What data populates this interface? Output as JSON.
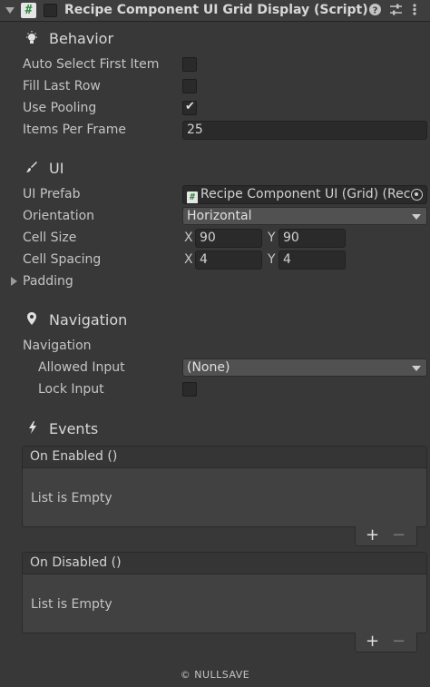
{
  "header": {
    "title": "Recipe Component UI Grid Display (Script)",
    "script_icon": "#",
    "icons": [
      "help-icon",
      "presets-icon",
      "more-icon"
    ]
  },
  "behavior": {
    "title": "Behavior",
    "auto_select_label": "Auto Select First Item",
    "auto_select_checked": false,
    "fill_last_row_label": "Fill Last Row",
    "fill_last_row_checked": false,
    "use_pooling_label": "Use Pooling",
    "use_pooling_checked": true,
    "items_per_frame_label": "Items Per Frame",
    "items_per_frame_value": "25"
  },
  "ui": {
    "title": "UI",
    "prefab_label": "UI Prefab",
    "prefab_value": "Recipe Component UI (Grid) (Rec",
    "orientation_label": "Orientation",
    "orientation_value": "Horizontal",
    "cell_size_label": "Cell Size",
    "cell_size": {
      "x_label": "X",
      "x": "90",
      "y_label": "Y",
      "y": "90"
    },
    "cell_spacing_label": "Cell Spacing",
    "cell_spacing": {
      "x_label": "X",
      "x": "4",
      "y_label": "Y",
      "y": "4"
    },
    "padding_label": "Padding"
  },
  "navigation": {
    "title": "Navigation",
    "group_label": "Navigation",
    "allowed_input_label": "Allowed Input",
    "allowed_input_value": "(None)",
    "lock_input_label": "Lock Input",
    "lock_input_checked": false
  },
  "events": {
    "title": "Events",
    "on_enabled": {
      "label": "On Enabled ()",
      "empty": "List is Empty"
    },
    "on_disabled": {
      "label": "On Disabled ()",
      "empty": "List is Empty"
    },
    "plus": "+",
    "minus": "−"
  },
  "footer": {
    "text": "© NULLSAVE"
  }
}
